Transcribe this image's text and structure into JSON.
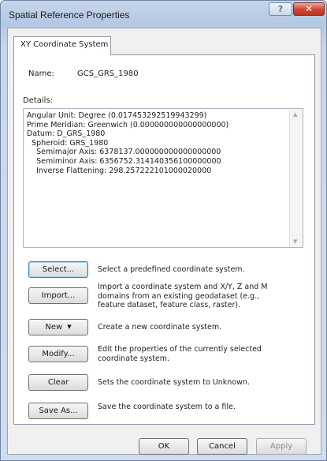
{
  "window": {
    "title": "Spatial Reference Properties",
    "help_glyph": "?",
    "close_glyph": "✕"
  },
  "tabs": [
    {
      "label": "XY Coordinate System",
      "selected": true
    }
  ],
  "name_field": {
    "label": "Name:",
    "value": "GCS_GRS_1980"
  },
  "details": {
    "label": "Details:",
    "text": "Angular Unit: Degree (0.017453292519943299)\nPrime Meridian: Greenwich (0.000000000000000000)\nDatum: D_GRS_1980\n  Spheroid: GRS_1980\n    Semimajor Axis: 6378137.000000000000000000\n    Semiminor Axis: 6356752.314140356100000000\n    Inverse Flattening: 298.257222101000020000"
  },
  "actions": [
    {
      "label": "Select...",
      "description": "Select a predefined coordinate system."
    },
    {
      "label": "Import...",
      "description": "Import a coordinate system and X/Y, Z and M domains from an existing geodataset (e.g., feature dataset, feature class, raster)."
    },
    {
      "label": "New",
      "description": "Create a new coordinate system."
    },
    {
      "label": "Modify...",
      "description": "Edit the properties of the currently selected coordinate system."
    },
    {
      "label": "Clear",
      "description": "Sets the coordinate system to Unknown."
    },
    {
      "label": "Save As...",
      "description": "Save the coordinate system to a file."
    }
  ],
  "dialog_buttons": {
    "ok": "OK",
    "cancel": "Cancel",
    "apply": "Apply"
  },
  "icons": {
    "scroll_up": "▲",
    "scroll_down": "▼",
    "dropdown": "▼"
  }
}
